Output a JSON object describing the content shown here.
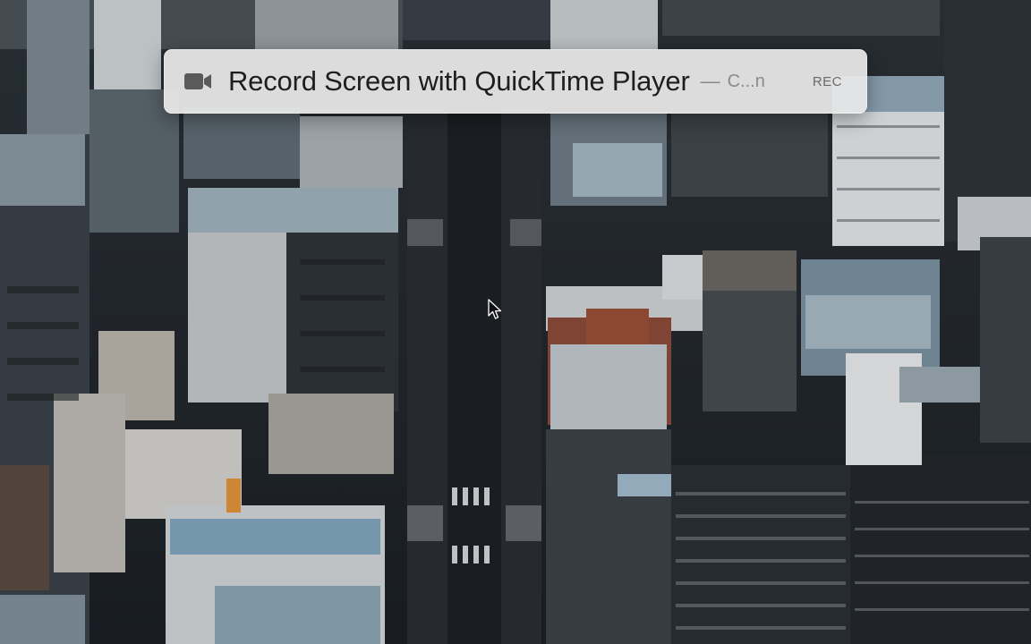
{
  "spotlight": {
    "query": "Record Screen with QuickTime Player",
    "separator": "—",
    "hint": "C...n",
    "badge": "REC",
    "icon": "video-camera-icon"
  },
  "cursor": {
    "icon": "mouse-pointer-icon"
  }
}
